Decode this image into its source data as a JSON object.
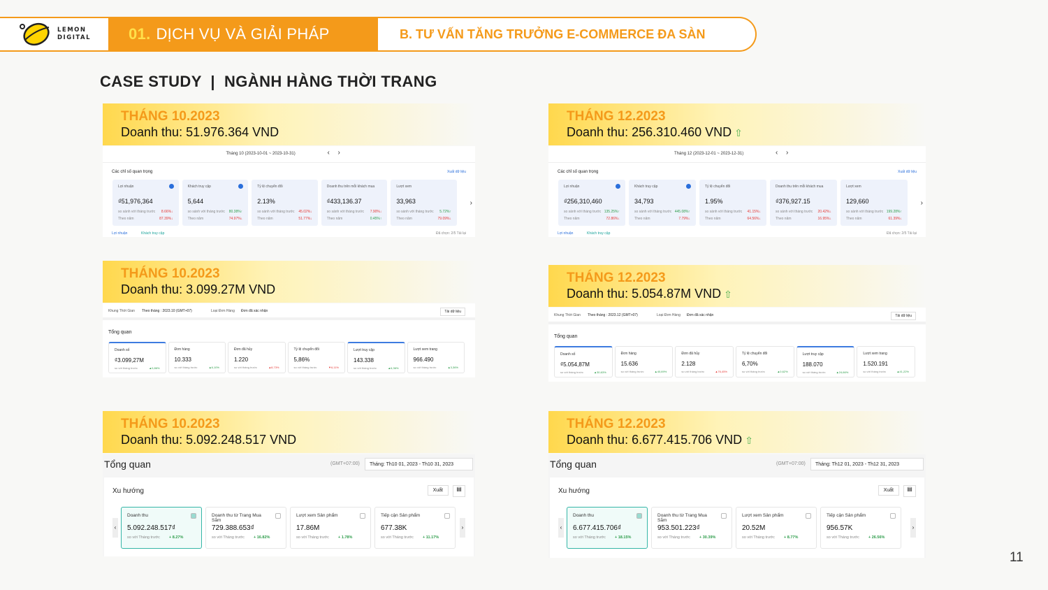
{
  "header": {
    "logo_word1": "LEMON",
    "logo_word2": "DIGITAL",
    "section_num": "01.",
    "section_title": "DỊCH VỤ VÀ GIẢI PHÁP",
    "subsection": "B. TƯ VẤN TĂNG TRƯỞNG E-COMMERCE ĐA SÀN"
  },
  "title": "CASE STUDY  |  NGÀNH HÀNG THỜI TRANG",
  "page_number": "11",
  "blocks": [
    {
      "month": "THÁNG 10.2023",
      "revenue": "Doanh thu: 51.976.364 VND",
      "up": false
    },
    {
      "month": "THÁNG 12.2023",
      "revenue": "Doanh thu: 256.310.460 VND",
      "up": true
    },
    {
      "month": "THÁNG 10.2023",
      "revenue": "Doanh thu: 3.099.27M VND",
      "up": false
    },
    {
      "month": "THÁNG 12.2023",
      "revenue": "Doanh thu: 5.054.87M VND",
      "up": true
    },
    {
      "month": "THÁNG 10.2023",
      "revenue": "Doanh thu: 5.092.248.517 VND",
      "up": false
    },
    {
      "month": "THÁNG 12.2023",
      "revenue": "Doanh thu: 6.677.415.706 VND",
      "up": true
    }
  ],
  "up_icon": "⇧",
  "shopee": [
    {
      "date": "Tháng 10  (2023-10-01 ~ 2023-10-31)",
      "heading": "Các chỉ số quan trọng",
      "download": "Xuất dữ liệu",
      "footer_legend1": "Lợi nhuận",
      "footer_legend2": "Khách truy cập",
      "footer_page": "Đã chọn: 2/5  Tải lại",
      "kpis": [
        {
          "label": "Lợi nhuận",
          "value": "₫51,976,364",
          "c1": "8.66%↓",
          "c2": "87.39%↓"
        },
        {
          "label": "Khách truy cập",
          "value": "5,644",
          "c1": "80.38%↑",
          "c2": "74.97%↓"
        },
        {
          "label": "Tỷ lệ chuyển đổi",
          "value": "2.13%",
          "c1": "45.02%↓",
          "c2": "51.77%↓"
        },
        {
          "label": "Doanh thu trên mỗi khách mua",
          "value": "₫433,136.37",
          "c1": "7.90%↓",
          "c2": "0.45%↑"
        },
        {
          "label": "Lượt xem",
          "value": "33,963",
          "c1": "5.72%↑",
          "c2": "79.09%↓"
        }
      ]
    },
    {
      "date": "Tháng 12  (2023-12-01 ~ 2023-12-31)",
      "heading": "Các chỉ số quan trọng",
      "download": "Xuất dữ liệu",
      "footer_legend1": "Lợi nhuận",
      "footer_legend2": "Khách truy cập",
      "footer_page": "Đã chọn: 2/5  Tải lại",
      "kpis": [
        {
          "label": "Lợi nhuận",
          "value": "₫256,310,460",
          "c1": "135.25%↑",
          "c2": "72.86%↓"
        },
        {
          "label": "Khách truy cập",
          "value": "34,793",
          "c1": "445.08%↑",
          "c2": "7.79%↓"
        },
        {
          "label": "Tỷ lệ chuyển đổi",
          "value": "1.95%",
          "c1": "41.15%↓",
          "c2": "64.56%↓"
        },
        {
          "label": "Doanh thu trên mỗi khách mua",
          "value": "₫376,927.15",
          "c1": "20.42%↓",
          "c2": "16.95%↓"
        },
        {
          "label": "Lượt xem",
          "value": "129,660",
          "c1": "199.28%↑",
          "c2": "61.39%↓"
        }
      ]
    }
  ],
  "lazada": [
    {
      "time_label": "Khung Thời Gian",
      "time_value": "Theo tháng :  2023.10 (GMT+07)",
      "order_label": "Loại Đơn Hàng",
      "order_value": "Đơn đã xác nhận",
      "download": "Tải dữ liệu",
      "overview": "Tổng quan",
      "kpis": [
        {
          "label": "Doanh số",
          "value": "₫3.099,27M",
          "chg": "▲0,86%"
        },
        {
          "label": "Đơn hàng",
          "value": "10.333",
          "chg": "▲6,10%"
        },
        {
          "label": "Đơn đã hủy",
          "value": "1.220",
          "chg": "▲8,73%"
        },
        {
          "label": "Tỷ lệ chuyển đổi",
          "value": "5,86%",
          "chg": "▼6,11%"
        },
        {
          "label": "Lượt truy cập",
          "value": "143.338",
          "chg": "▲6,36%"
        },
        {
          "label": "Lượt xem trang",
          "value": "966.490",
          "chg": "▲3,36%"
        }
      ]
    },
    {
      "time_label": "Khung Thời Gian",
      "time_value": "Theo tháng :  2023.12 (GMT+07)",
      "order_label": "Loại Đơn Hàng",
      "order_value": "Đơn đã xác nhận",
      "download": "Tải dữ liệu",
      "overview": "Tổng quan",
      "kpis": [
        {
          "label": "Doanh số",
          "value": "₫5.054,87M",
          "chg": "▲30,63%"
        },
        {
          "label": "Đơn hàng",
          "value": "15.636",
          "chg": "▲40,69%"
        },
        {
          "label": "Đơn đã hủy",
          "value": "2.128",
          "chg": "▲76,45%"
        },
        {
          "label": "Tỷ lệ chuyển đổi",
          "value": "6,70%",
          "chg": "▲0,62%"
        },
        {
          "label": "Lượt truy cập",
          "value": "188.070",
          "chg": "▲24,66%"
        },
        {
          "label": "Lượt xem trang",
          "value": "1.520.191",
          "chg": "▲41,22%"
        }
      ]
    }
  ],
  "tiktok": [
    {
      "overview": "Tổng quan",
      "tz": "(GMT+07:00)",
      "range": "Tháng:  Th10 01, 2023  -  Th10 31, 2023",
      "trend": "Xu hướng",
      "export": "Xuất",
      "compare": "so với Tháng trước",
      "kpis": [
        {
          "label": "Doanh thu",
          "value": "5.092.248.517₫",
          "chg": "+ 8.27%"
        },
        {
          "label": "Doanh thu từ Trang Mua Sắm",
          "value": "729.388.653₫",
          "chg": "+ 16.82%"
        },
        {
          "label": "Lượt xem Sản phẩm",
          "value": "17.86M",
          "chg": "+ 1.78%"
        },
        {
          "label": "Tiếp cận Sản phẩm",
          "value": "677.38K",
          "chg": "+ 11.17%"
        }
      ]
    },
    {
      "overview": "Tổng quan",
      "tz": "(GMT+07:00)",
      "range": "Tháng:  Th12 01, 2023  -  Th12 31, 2023",
      "trend": "Xu hướng",
      "export": "Xuất",
      "compare": "so với Tháng trước",
      "kpis": [
        {
          "label": "Doanh thu",
          "value": "6.677.415.706₫",
          "chg": "+ 18.15%"
        },
        {
          "label": "Doanh thu từ Trang Mua Sắm",
          "value": "953.501.223₫",
          "chg": "+ 30.39%"
        },
        {
          "label": "Lượt xem Sản phẩm",
          "value": "20.52M",
          "chg": "+ 8.77%"
        },
        {
          "label": "Tiếp cận Sản phẩm",
          "value": "956.57K",
          "chg": "+ 26.56%"
        }
      ]
    }
  ],
  "colors": {
    "orange": "#f49a1a",
    "yellow": "#ffd84d",
    "green": "#2e9d4b",
    "red": "#e53935",
    "teal": "#1aa39a"
  }
}
